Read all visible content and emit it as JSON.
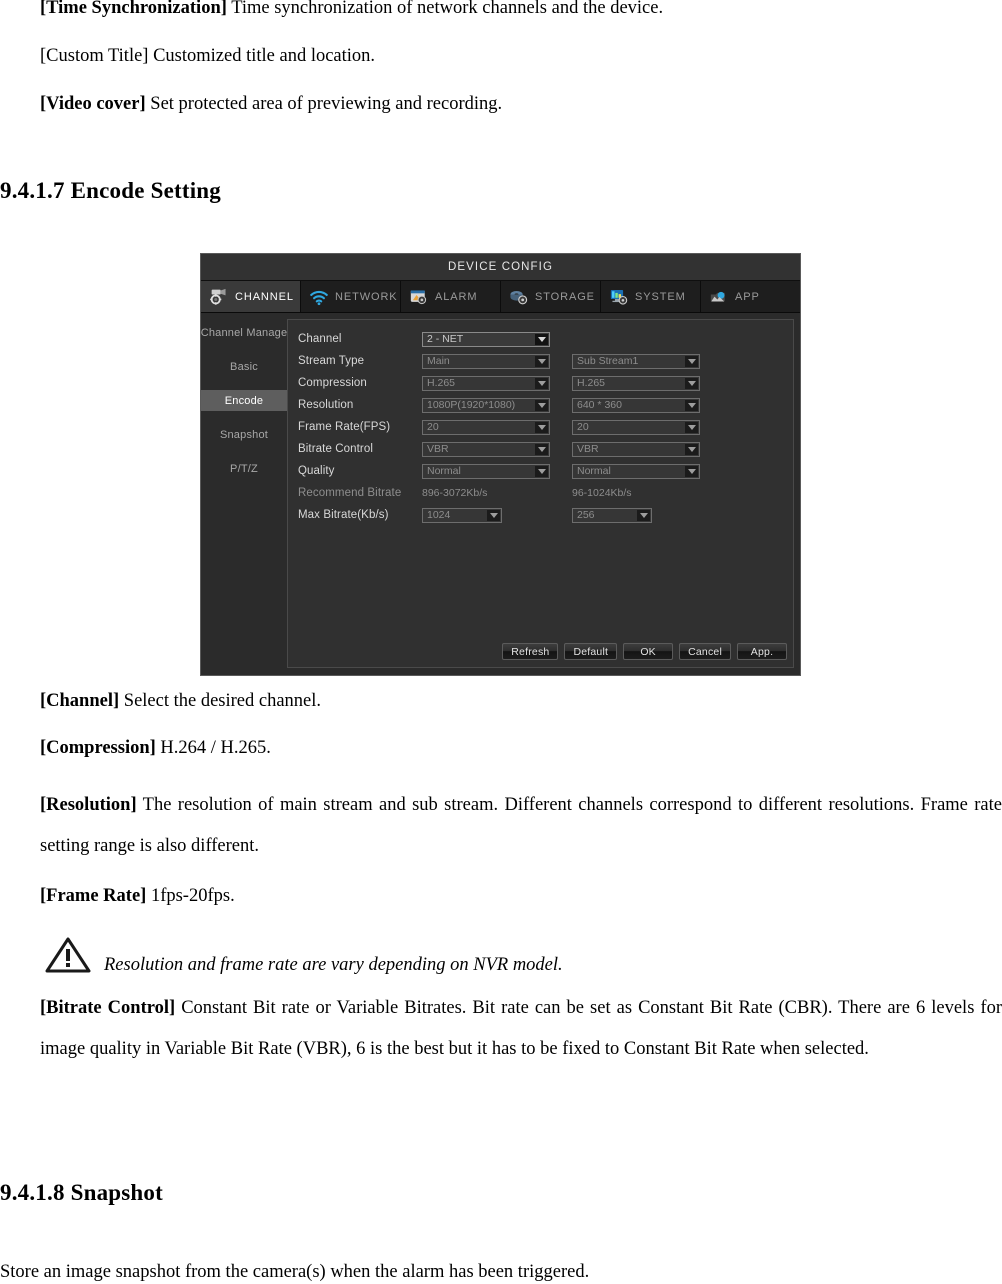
{
  "document": {
    "top_lines": [
      {
        "bold": "[Time Synchronization]",
        "rest": " Time synchronization of network channels and the device."
      },
      {
        "bold": "",
        "rest": "[Custom Title] Customized title and location."
      },
      {
        "bold": "[Video cover]",
        "rest": " Set protected area of previewing and recording."
      }
    ],
    "heading_encode": "9.4.1.7 Encode Setting",
    "heading_snapshot": "9.4.1.8 Snapshot",
    "after_figure": {
      "channel": {
        "bold": "[Channel]",
        "rest": " Select the desired channel."
      },
      "compression": {
        "bold": "[Compression]",
        "rest": " H.264 / H.265."
      },
      "resolution": {
        "bold": "[Resolution]",
        "rest": " The resolution of main stream and sub stream. Different channels correspond to different resolutions. Frame rate setting range is also different."
      },
      "frame_rate": {
        "bold": "[Frame Rate]",
        "rest": " 1fps-20fps."
      },
      "warning_note": "Resolution and frame rate are vary depending on NVR model.",
      "bitrate_control": {
        "bold": "[Bitrate Control]",
        "rest": " Constant Bit rate or Variable Bitrates. Bit rate can be set as Constant Bit Rate (CBR). There are 6 levels for image quality in Variable Bit Rate (VBR), 6 is the best but it has to be fixed to Constant Bit Rate when selected."
      },
      "snapshot_desc": "Store an image snapshot from the camera(s) when the alarm has been triggered."
    }
  },
  "nvr": {
    "title": "DEVICE CONFIG",
    "tabs": [
      {
        "label": "CHANNEL",
        "icon": "camera-gear-icon",
        "active": true
      },
      {
        "label": "NETWORK",
        "icon": "wifi-icon",
        "active": false
      },
      {
        "label": "ALARM",
        "icon": "alarm-bell-icon",
        "active": false
      },
      {
        "label": "STORAGE",
        "icon": "disk-gear-icon",
        "active": false
      },
      {
        "label": "SYSTEM",
        "icon": "monitor-gear-icon",
        "active": false
      },
      {
        "label": "APP",
        "icon": "cloud-app-icon",
        "active": false
      }
    ],
    "sidebar": [
      {
        "label": "Channel Manage",
        "active": false
      },
      {
        "label": "Basic",
        "active": false
      },
      {
        "label": "Encode",
        "active": true
      },
      {
        "label": "Snapshot",
        "active": false
      },
      {
        "label": "P/T/Z",
        "active": false
      }
    ],
    "form": {
      "channel": {
        "label": "Channel",
        "value": "2 - NET",
        "enabled": true
      },
      "stream_type": {
        "label": "Stream Type",
        "main": "Main",
        "sub": "Sub Stream1"
      },
      "compression": {
        "label": "Compression",
        "main": "H.265",
        "sub": "H.265"
      },
      "resolution": {
        "label": "Resolution",
        "main": "1080P(1920*1080)",
        "sub": "640 * 360"
      },
      "frame_rate": {
        "label": "Frame Rate(FPS)",
        "main": "20",
        "sub": "20"
      },
      "bitrate_control": {
        "label": "Bitrate Control",
        "main": "VBR",
        "sub": "VBR"
      },
      "quality": {
        "label": "Quality",
        "main": "Normal",
        "sub": "Normal"
      },
      "recommend_bitrate": {
        "label": "Recommend Bitrate",
        "main": "896-3072Kb/s",
        "sub": "96-1024Kb/s"
      },
      "max_bitrate": {
        "label": "Max Bitrate(Kb/s)",
        "main": "1024",
        "sub": "256"
      }
    },
    "buttons": [
      {
        "label": "Refresh"
      },
      {
        "label": "Default"
      },
      {
        "label": "OK"
      },
      {
        "label": "Cancel"
      },
      {
        "label": "App."
      }
    ],
    "colors": {
      "window_bg": "#2b2b2b",
      "titlebar_bg": "#323232",
      "tabbar_bg": "#1e1e1e",
      "active_tab_bg": "#3a3a3a",
      "active_side_bg": "#5e5e5e",
      "panel_bg": "#303030",
      "wifi_accent": "#2fa8e0"
    }
  }
}
